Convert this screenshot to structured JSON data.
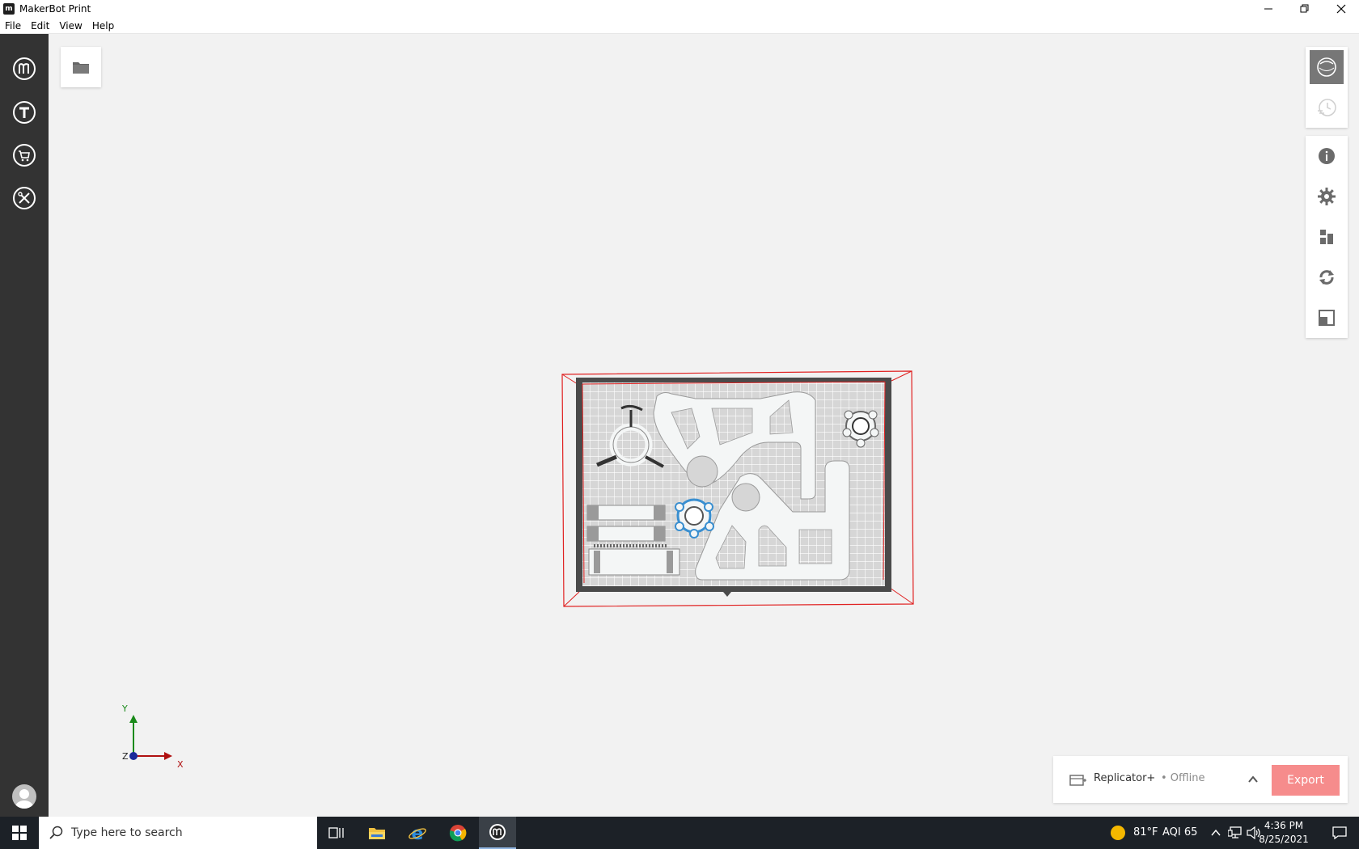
{
  "window": {
    "title": "MakerBot Print",
    "app_icon_glyph": "m"
  },
  "menu": {
    "items": [
      "File",
      "Edit",
      "View",
      "Help"
    ]
  },
  "leftnav": {
    "items": [
      {
        "name": "makerbot-logo-icon"
      },
      {
        "name": "thingiverse-icon"
      },
      {
        "name": "cart-icon"
      },
      {
        "name": "tools-icon"
      }
    ],
    "avatar": "user-avatar-icon"
  },
  "right_panel": {
    "view_modes": [
      "model-view-icon",
      "print-preview-icon"
    ],
    "tools": [
      "info-icon",
      "settings-gear-icon",
      "arrange-icon",
      "rotate-icon",
      "scale-icon"
    ]
  },
  "axis": {
    "x": "X",
    "y": "Y",
    "z": "Z"
  },
  "printer": {
    "name": "Replicator+",
    "status": "• Offline",
    "export_label": "Export"
  },
  "taskbar": {
    "search_placeholder": "Type here to search",
    "weather_temp": "81°F",
    "aqi": "AQI 65",
    "time": "4:36 PM",
    "date": "8/25/2021"
  },
  "colors": {
    "nav_bg": "#333333",
    "export": "#f68c8c",
    "bbox": "#e02020",
    "selected": "#3a8fd0"
  }
}
